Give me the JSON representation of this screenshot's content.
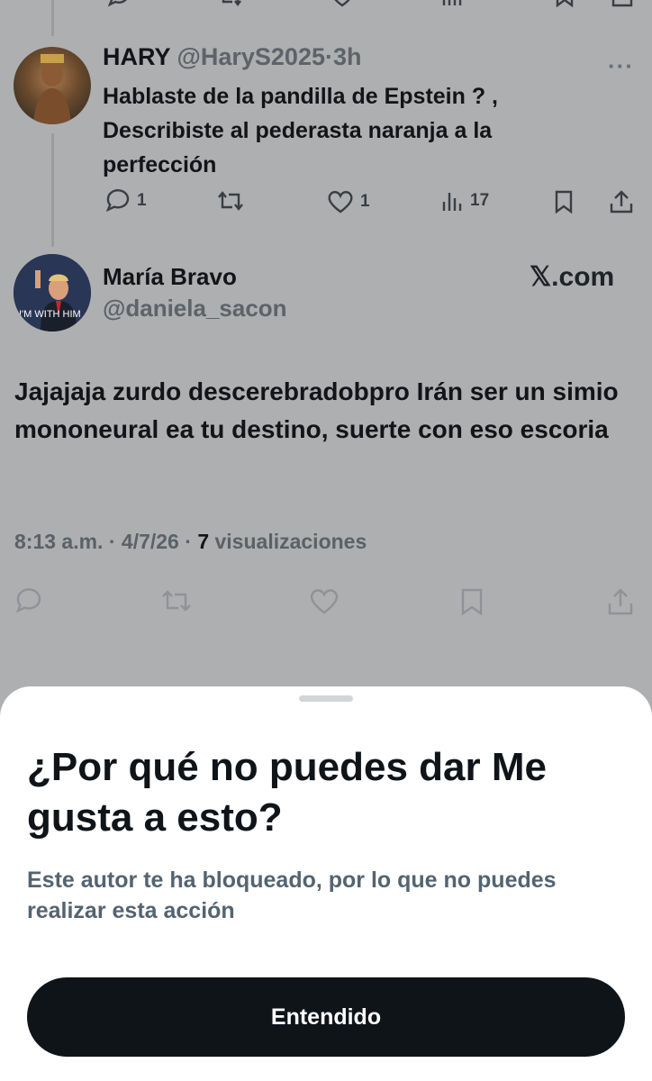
{
  "top_action_bar": {
    "icons": [
      "reply-icon",
      "retweet-icon",
      "like-icon",
      "views-icon",
      "bookmark-icon",
      "share-icon"
    ]
  },
  "reply": {
    "name": "HARY",
    "handle": "@HaryS2025",
    "separator": "·",
    "time": "3h",
    "more": "···",
    "text": "Hablaste de la pandilla de Epstein ? , Describiste al pederasta naranja a la perfección",
    "actions": {
      "replies": "1",
      "likes": "1",
      "views": "17"
    }
  },
  "main_tweet": {
    "name": "María Bravo",
    "handle": "@daniela_sacon",
    "brand": "𝕏.com",
    "avatar_text": "I'M WITH HIM",
    "text": "Jajajaja zurdo descerebradobpro Irán ser un simio mononeural ea tu destino, suerte con eso escoria",
    "time": "8:13 a.m.",
    "date": "4/7/26",
    "sep": "·",
    "views_count": "7",
    "views_label": "visualizaciones"
  },
  "sheet": {
    "title": "¿Por qué no puedes dar Me gusta a esto?",
    "description": "Este autor te ha bloqueado, por lo que no puedes realizar esta acción",
    "button_label": "Entendido"
  },
  "colors": {
    "overlay_bg": "#aeafb0",
    "sheet_bg": "#ffffff",
    "button_bg": "#0f1419",
    "muted_text": "#536471"
  }
}
